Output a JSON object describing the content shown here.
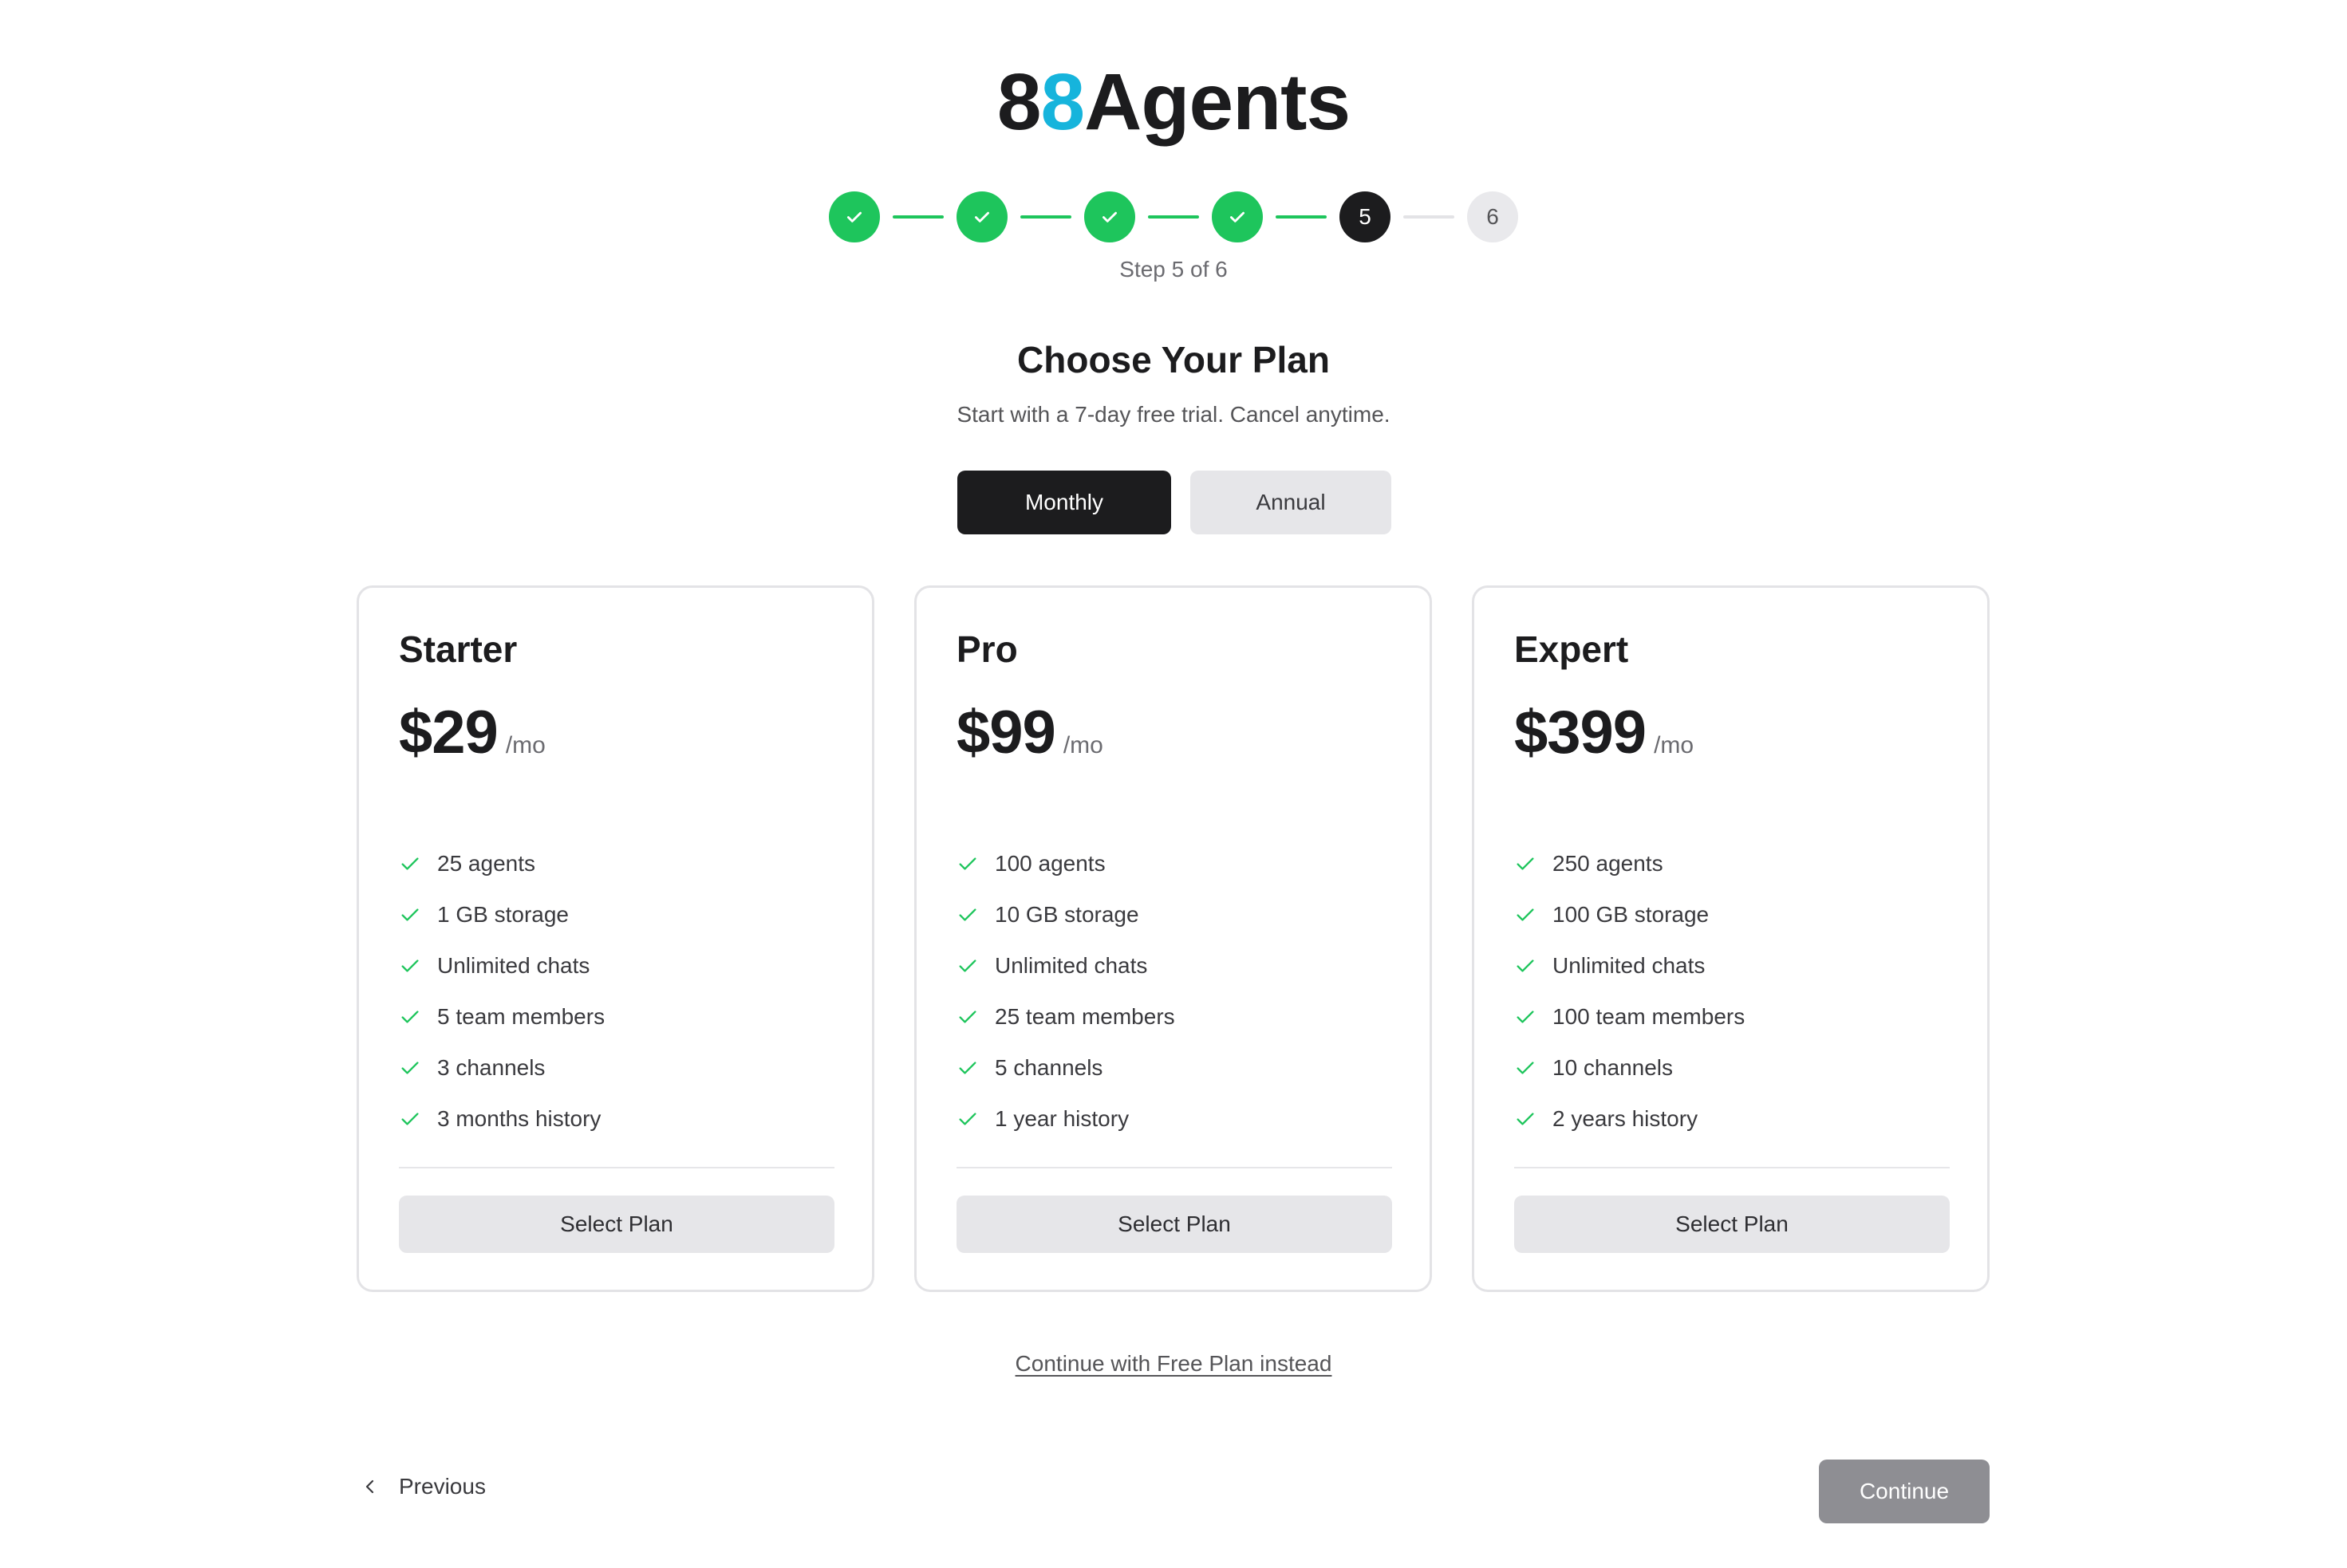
{
  "brand": {
    "logo_prefix": "8",
    "logo_accent": "8",
    "logo_suffix": "Agents",
    "accent_color": "#16b4dc"
  },
  "stepper": {
    "steps": [
      {
        "label": "",
        "state": "done",
        "icon": "check-icon"
      },
      {
        "label": "",
        "state": "done",
        "icon": "check-icon"
      },
      {
        "label": "",
        "state": "done",
        "icon": "check-icon"
      },
      {
        "label": "",
        "state": "done",
        "icon": "check-icon"
      },
      {
        "label": "5",
        "state": "current"
      },
      {
        "label": "6",
        "state": "future"
      }
    ],
    "progress_text": "Step 5 of 6",
    "done_color": "#1ec55c"
  },
  "header": {
    "title": "Choose Your Plan",
    "subtitle": "Start with a 7-day free trial. Cancel anytime."
  },
  "billing_toggle": {
    "monthly_label": "Monthly",
    "annual_label": "Annual",
    "selected": "Monthly"
  },
  "plans": [
    {
      "name": "Starter",
      "price": "$29",
      "period": "/mo",
      "features": [
        "25 agents",
        "1 GB storage",
        "Unlimited chats",
        "5 team members",
        "3 channels",
        "3 months history"
      ],
      "button_label": "Select Plan"
    },
    {
      "name": "Pro",
      "price": "$99",
      "period": "/mo",
      "features": [
        "100 agents",
        "10 GB storage",
        "Unlimited chats",
        "25 team members",
        "5 channels",
        "1 year history"
      ],
      "button_label": "Select Plan"
    },
    {
      "name": "Expert",
      "price": "$399",
      "period": "/mo",
      "features": [
        "250 agents",
        "100 GB storage",
        "Unlimited chats",
        "100 team members",
        "10 channels",
        "2 years history"
      ],
      "button_label": "Select Plan"
    }
  ],
  "free_plan_link": "Continue with Free Plan instead",
  "navigation": {
    "previous_label": "Previous",
    "continue_label": "Continue"
  }
}
